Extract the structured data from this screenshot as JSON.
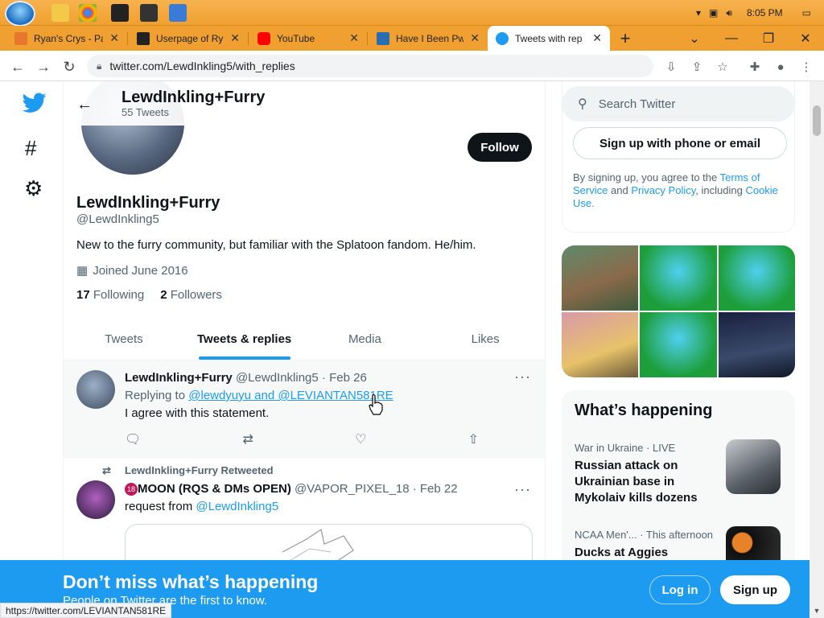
{
  "taskbar": {
    "time": "8:05 PM"
  },
  "browser": {
    "tabs": [
      {
        "title": "Ryan's Crys - Pa",
        "favicon_color": "#e8772e"
      },
      {
        "title": "Userpage of Ry",
        "favicon_color": "#222222"
      },
      {
        "title": "YouTube",
        "favicon_color": "#ff0000"
      },
      {
        "title": "Have I Been Pw",
        "favicon_color": "#2a6db0"
      },
      {
        "title": "Tweets with rep",
        "favicon_color": "#1d9bf0"
      }
    ],
    "new_tab_label": "+",
    "url": "twitter.com/LewdInkling5/with_replies",
    "status_url": "https://twitter.com/LEVIANTAN581RE"
  },
  "profile": {
    "header_name": "LewdInkling+Furry",
    "tweet_count": "55 Tweets",
    "follow_label": "Follow",
    "name": "LewdInkling+Furry",
    "handle": "@LewdInkling5",
    "bio": "New to the furry community, but familiar with the Splatoon fandom. He/him.",
    "joined": "Joined June 2016",
    "following_count": "17",
    "following_label": "Following",
    "followers_count": "2",
    "followers_label": "Followers",
    "tabs": [
      "Tweets",
      "Tweets & replies",
      "Media",
      "Likes"
    ]
  },
  "tweets": [
    {
      "name": "LewdInkling+Furry",
      "handle": "@LewdInkling5",
      "date": "· Feb 26",
      "replying_prefix": "Replying to",
      "replying_to": "@lewdyuyu and @LEVIANTAN581RE",
      "text": "I agree with this statement."
    },
    {
      "retweet_label": "LewdInkling+Furry Retweeted",
      "name": "MOON (RQS & DMs OPEN)",
      "handle": "@VAPOR_PIXEL_18",
      "date": "· Feb 22",
      "text_prefix": "request from",
      "mention": "@LewdInkling5"
    }
  ],
  "sidebar": {
    "search_placeholder": "Search Twitter",
    "signup_phone_label": "Sign up with phone or email",
    "terms_prefix": "By signing up, you agree to the",
    "terms_link": "Terms of Service",
    "terms_and": "and",
    "privacy_link": "Privacy Policy",
    "terms_including": ", including",
    "cookie_link": "Cookie Use.",
    "whats_happening": "What’s happening",
    "trends": [
      {
        "meta": "War in Ukraine · LIVE",
        "title": "Russian attack on Ukrainian base in Mykolaiv kills dozens"
      },
      {
        "meta": "NCAA Men'... · This afternoon",
        "title": "Ducks at Aggies"
      }
    ]
  },
  "banner": {
    "title": "Don’t miss what’s happening",
    "subtitle": "People on Twitter are the first to know.",
    "login_label": "Log in",
    "signup_label": "Sign up"
  }
}
